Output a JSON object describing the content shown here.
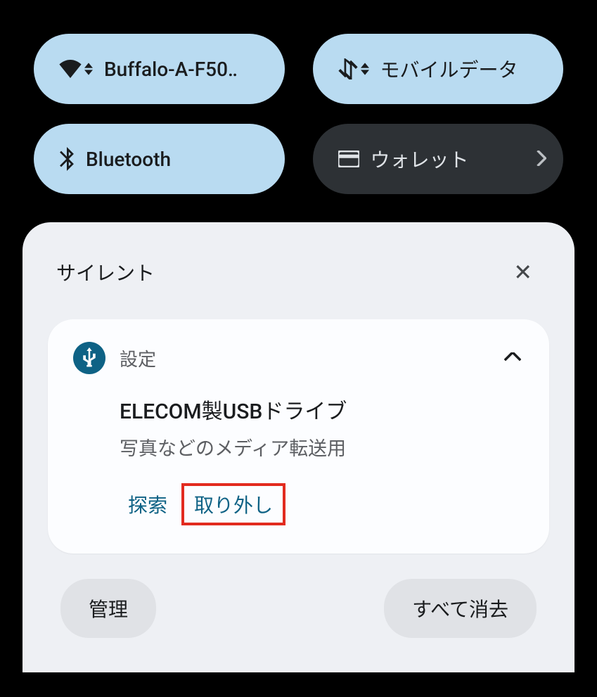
{
  "qs": {
    "wifi": {
      "label": "Buffalo-A-F50‥"
    },
    "mobile": {
      "label": "モバイルデータ"
    },
    "bluetooth": {
      "label": "Bluetooth"
    },
    "wallet": {
      "label": "ウォレット"
    }
  },
  "notif": {
    "section": "サイレント",
    "app": "設定",
    "title": "ELECOM製USBドライブ",
    "desc": "写真などのメディア転送用",
    "actions": {
      "explore": "探索",
      "eject": "取り外し"
    }
  },
  "footer": {
    "manage": "管理",
    "clear_all": "すべて消去"
  }
}
